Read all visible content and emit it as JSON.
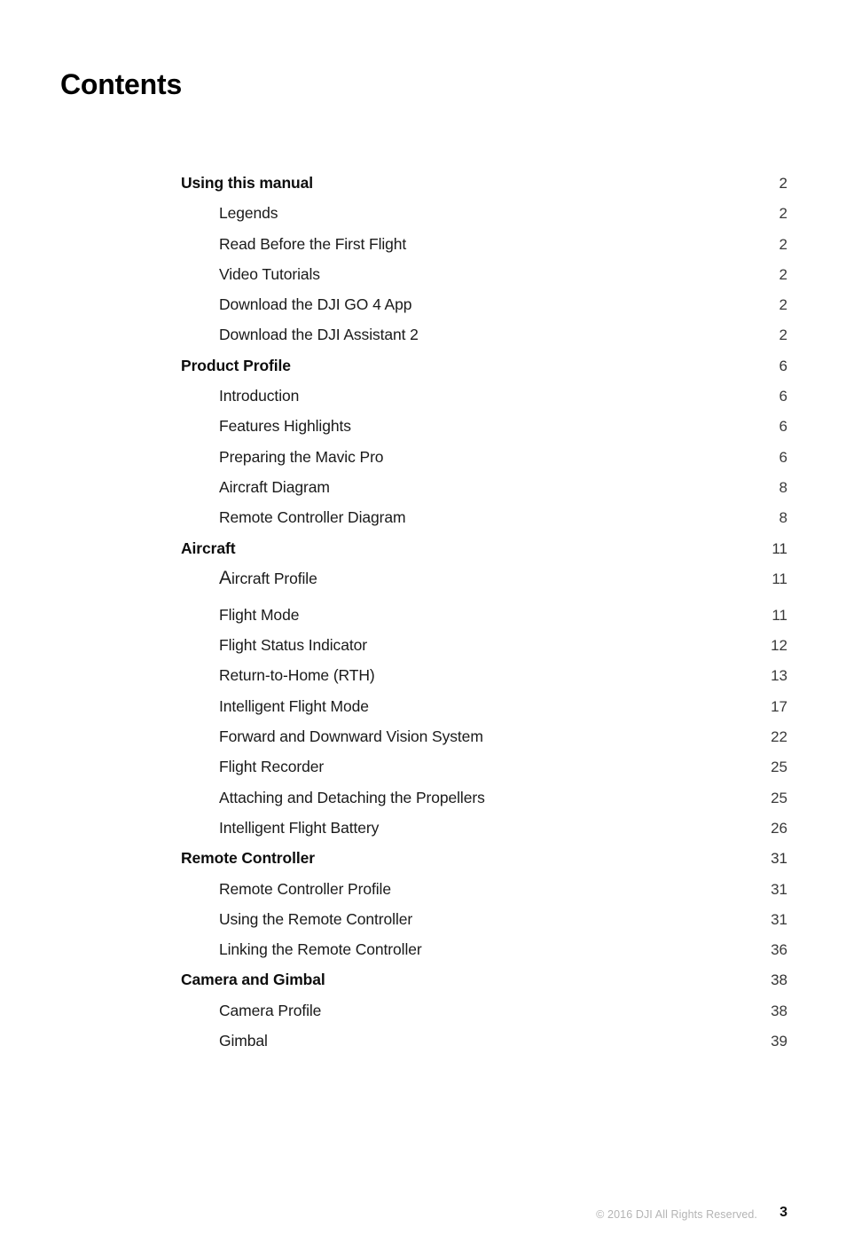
{
  "document": {
    "title": "Contents"
  },
  "toc": {
    "sections": [
      {
        "label": "Using this manual",
        "page": "2",
        "entries": [
          {
            "label": "Legends",
            "page": "2"
          },
          {
            "label": "Read Before the First Flight",
            "page": "2"
          },
          {
            "label": "Video Tutorials",
            "page": "2"
          },
          {
            "label": "Download the DJI GO 4 App",
            "page": "2"
          },
          {
            "label": "Download the DJI Assistant 2",
            "page": "2"
          }
        ]
      },
      {
        "label": "Product Profile",
        "page": "6",
        "entries": [
          {
            "label": "Introduction",
            "page": "6"
          },
          {
            "label": "Features Highlights",
            "page": "6"
          },
          {
            "label": "Preparing the Mavic Pro",
            "page": "6"
          },
          {
            "label": "Aircraft Diagram",
            "page": "8"
          },
          {
            "label": "Remote Controller Diagram",
            "page": "8"
          }
        ]
      },
      {
        "label": "Aircraft",
        "page": "11",
        "entries": [
          {
            "label_first": "A",
            "label_rest": "ircraft Profile",
            "page": "11",
            "extra_gap": true
          },
          {
            "label": "Flight Mode",
            "page": "11"
          },
          {
            "label": "Flight Status Indicator",
            "page": "12"
          },
          {
            "label": "Return-to-Home (RTH)",
            "page": "13"
          },
          {
            "label": "Intelligent Flight Mode",
            "page": "17"
          },
          {
            "label": "Forward and Downward Vision System",
            "page": "22"
          },
          {
            "label": "Flight Recorder",
            "page": "25"
          },
          {
            "label": "Attaching and Detaching the Propellers",
            "page": "25"
          },
          {
            "label": "Intelligent Flight Battery",
            "page": "26"
          }
        ]
      },
      {
        "label": "Remote Controller",
        "page": "31",
        "entries": [
          {
            "label": "Remote Controller Profile",
            "page": "31"
          },
          {
            "label": "Using the Remote Controller",
            "page": "31"
          },
          {
            "label": "Linking the Remote Controller",
            "page": "36"
          }
        ]
      },
      {
        "label": "Camera and Gimbal",
        "page": "38",
        "entries": [
          {
            "label": "Camera Profile",
            "page": "38"
          },
          {
            "label": "Gimbal",
            "page": "39"
          }
        ]
      }
    ]
  },
  "footer": {
    "copyright": "© 2016 DJI All Rights Reserved.",
    "page_number": "3"
  }
}
